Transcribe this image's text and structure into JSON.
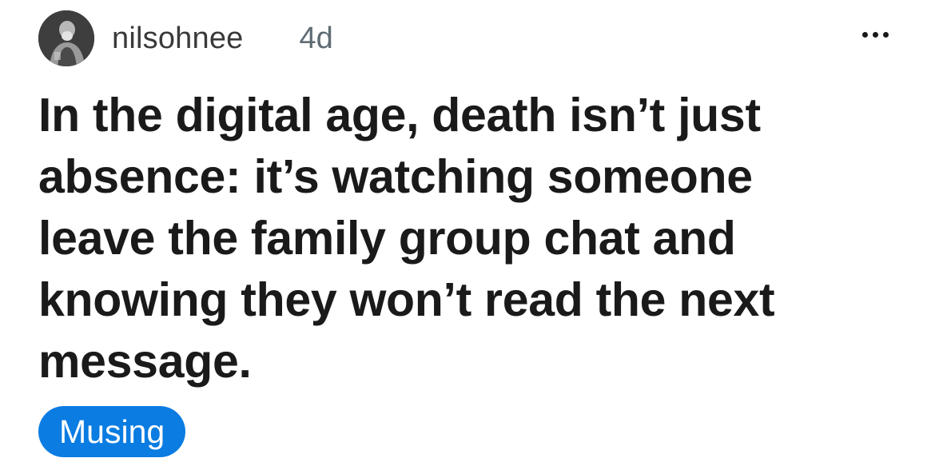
{
  "post": {
    "author": {
      "username": "nilsohnee",
      "avatar_icon": "user-avatar-icon"
    },
    "age": "4d",
    "menu_icon": "more-options-icon",
    "title": "In the digital age, death isn’t just absence: it’s watching someone leave the family group chat and knowing they won’t read the next message.",
    "flair": {
      "label": "Musing",
      "color": "#0a7ce2"
    }
  }
}
